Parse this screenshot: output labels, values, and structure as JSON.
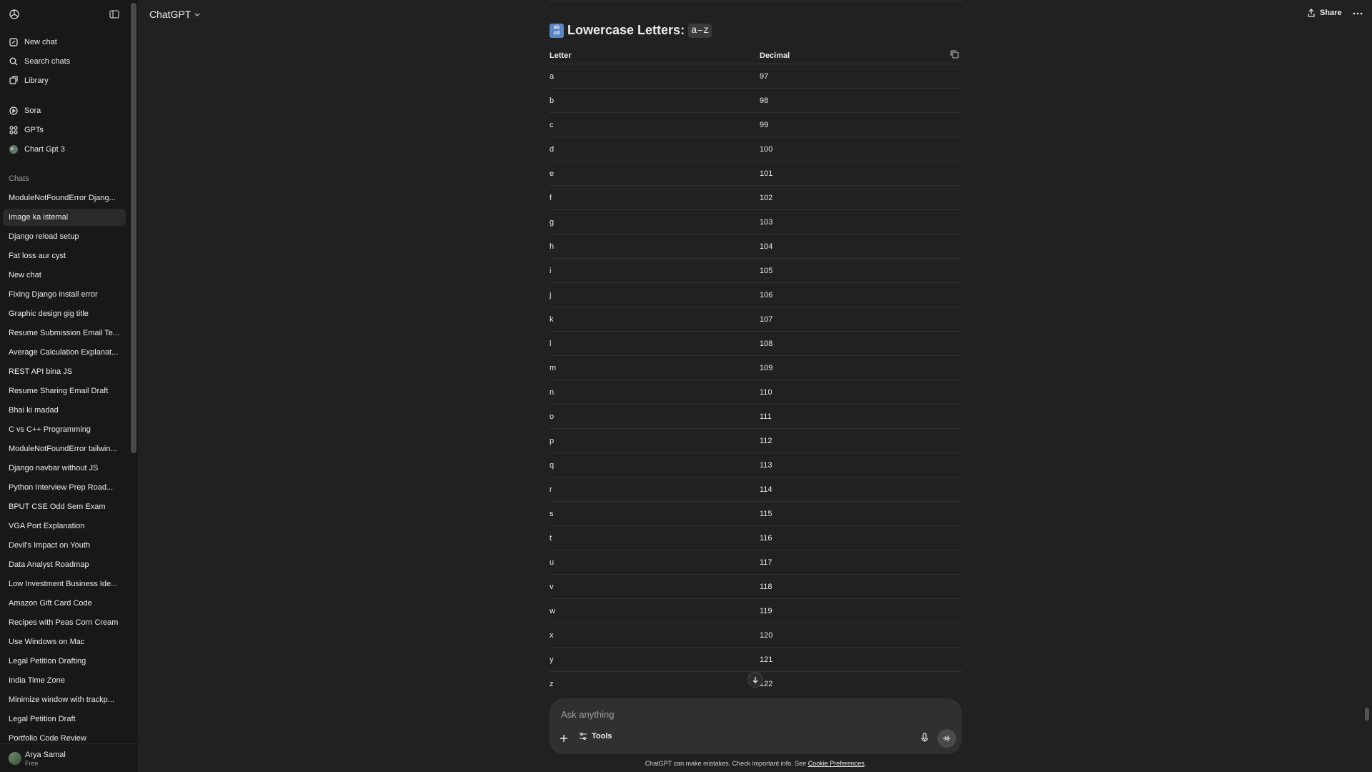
{
  "sidebar": {
    "nav": [
      {
        "label": "New chat",
        "icon": "new-chat-icon"
      },
      {
        "label": "Search chats",
        "icon": "search-icon"
      },
      {
        "label": "Library",
        "icon": "library-icon"
      }
    ],
    "gpts": [
      {
        "label": "Sora",
        "icon": "sora-icon"
      },
      {
        "label": "GPTs",
        "icon": "gpts-icon"
      },
      {
        "label": "Chart Gpt 3",
        "icon": "custom-gpt-avatar-icon"
      }
    ],
    "chats_label": "Chats",
    "chats": [
      "ModuleNotFoundError Djang...",
      "Image ka istemal",
      "Django reload setup",
      "Fat loss aur cyst",
      "New chat",
      "Fixing Django install error",
      "Graphic design gig title",
      "Resume Submission Email Te...",
      "Average Calculation Explanat...",
      "REST API bina JS",
      "Resume Sharing Email Draft",
      "Bhai ki madad",
      "C vs C++ Programming",
      "ModuleNotFoundError tailwin...",
      "Django navbar without JS",
      "Python Interview Prep Road...",
      "BPUT CSE Odd Sem Exam",
      "VGA Port Explanation",
      "Devil's Impact on Youth",
      "Data Analyst Roadmap",
      "Low Investment Business Ide...",
      "Amazon Gift Card Code",
      "Recipes with Peas Corn Cream",
      "Use Windows on Mac",
      "Legal Petition Drafting",
      "India Time Zone",
      "Minimize window with trackp...",
      "Legal Petition Draft",
      "Portfolio Code Review"
    ],
    "active_chat": "Image ka istemal",
    "user": {
      "name": "Arya Samal",
      "plan": "Free"
    }
  },
  "header": {
    "model": "ChatGPT",
    "share_label": "Share"
  },
  "content": {
    "heading_emoji": "🔡",
    "heading_text": "Lowercase Letters:",
    "heading_code": "a–z",
    "table": {
      "headers": [
        "Letter",
        "Decimal"
      ],
      "rows": [
        [
          "a",
          "97"
        ],
        [
          "b",
          "98"
        ],
        [
          "c",
          "99"
        ],
        [
          "d",
          "100"
        ],
        [
          "e",
          "101"
        ],
        [
          "f",
          "102"
        ],
        [
          "g",
          "103"
        ],
        [
          "h",
          "104"
        ],
        [
          "i",
          "105"
        ],
        [
          "j",
          "106"
        ],
        [
          "k",
          "107"
        ],
        [
          "l",
          "108"
        ],
        [
          "m",
          "109"
        ],
        [
          "n",
          "110"
        ],
        [
          "o",
          "111"
        ],
        [
          "p",
          "112"
        ],
        [
          "q",
          "113"
        ],
        [
          "r",
          "114"
        ],
        [
          "s",
          "115"
        ],
        [
          "t",
          "116"
        ],
        [
          "u",
          "117"
        ],
        [
          "v",
          "118"
        ],
        [
          "w",
          "119"
        ],
        [
          "x",
          "120"
        ],
        [
          "y",
          "121"
        ],
        [
          "z",
          "122"
        ]
      ]
    }
  },
  "composer": {
    "placeholder": "Ask anything",
    "tools_label": "Tools"
  },
  "footer": {
    "disclaimer": "ChatGPT can make mistakes. Check important info. See ",
    "link": "Cookie Preferences",
    "suffix": "."
  },
  "colors": {
    "background": "#212121",
    "sidebar": "#181818",
    "composer": "#303030",
    "text": "#ececec"
  }
}
